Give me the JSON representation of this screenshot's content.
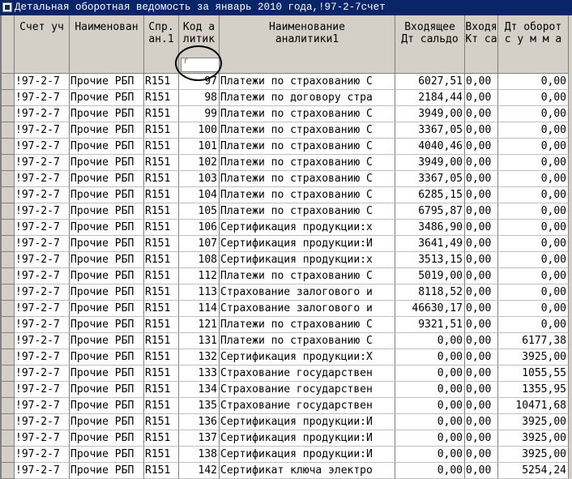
{
  "window": {
    "title": "Детальная оборотная ведомость за январь 2010 года,!97-2-7счет"
  },
  "table": {
    "columns": [
      {
        "key": "account",
        "label": "Счет уч"
      },
      {
        "key": "name",
        "label": "Наименован"
      },
      {
        "key": "ref",
        "label": "Спр.\nан.1"
      },
      {
        "key": "code",
        "label": "Код а\nлитик"
      },
      {
        "key": "analytic_name",
        "label": "Наименование\nаналитики1"
      },
      {
        "key": "opening_dt",
        "label": "Входящее\nДт сальдо"
      },
      {
        "key": "opening_kt",
        "label": "Входя\nКт са"
      },
      {
        "key": "turnover_dt",
        "label": "Дт оборот\nс у м м а"
      }
    ],
    "rows": [
      {
        "account": "!97-2-7",
        "name": "Прочие РБП",
        "ref": "R151",
        "code": "97",
        "analytic_name": "Платежи по страхованию С",
        "opening_dt": "6027,51",
        "opening_kt": "0,00",
        "turnover_dt": "0,00"
      },
      {
        "account": "!97-2-7",
        "name": "Прочие РБП",
        "ref": "R151",
        "code": "98",
        "analytic_name": "Платежи по договору стра",
        "opening_dt": "2184,44",
        "opening_kt": "0,00",
        "turnover_dt": "0,00"
      },
      {
        "account": "!97-2-7",
        "name": "Прочие РБП",
        "ref": "R151",
        "code": "99",
        "analytic_name": "Платежи по страхованию С",
        "opening_dt": "3949,00",
        "opening_kt": "0,00",
        "turnover_dt": "0,00"
      },
      {
        "account": "!97-2-7",
        "name": "Прочие РБП",
        "ref": "R151",
        "code": "100",
        "analytic_name": "Платежи по страхованию С",
        "opening_dt": "3367,05",
        "opening_kt": "0,00",
        "turnover_dt": "0,00"
      },
      {
        "account": "!97-2-7",
        "name": "Прочие РБП",
        "ref": "R151",
        "code": "101",
        "analytic_name": "Платежи по страхованию С",
        "opening_dt": "4040,46",
        "opening_kt": "0,00",
        "turnover_dt": "0,00"
      },
      {
        "account": "!97-2-7",
        "name": "Прочие РБП",
        "ref": "R151",
        "code": "102",
        "analytic_name": "Платежи по страхованию С",
        "opening_dt": "3949,00",
        "opening_kt": "0,00",
        "turnover_dt": "0,00"
      },
      {
        "account": "!97-2-7",
        "name": "Прочие РБП",
        "ref": "R151",
        "code": "103",
        "analytic_name": "Платежи по страхованию С",
        "opening_dt": "3367,05",
        "opening_kt": "0,00",
        "turnover_dt": "0,00"
      },
      {
        "account": "!97-2-7",
        "name": "Прочие РБП",
        "ref": "R151",
        "code": "104",
        "analytic_name": "Платежи по страхованию С",
        "opening_dt": "6285,15",
        "opening_kt": "0,00",
        "turnover_dt": "0,00"
      },
      {
        "account": "!97-2-7",
        "name": "Прочие РБП",
        "ref": "R151",
        "code": "105",
        "analytic_name": "Платежи по страхованию С",
        "opening_dt": "6795,87",
        "opening_kt": "0,00",
        "turnover_dt": "0,00"
      },
      {
        "account": "!97-2-7",
        "name": "Прочие РБП",
        "ref": "R151",
        "code": "106",
        "analytic_name": "Сертификация продукции:х",
        "opening_dt": "3486,90",
        "opening_kt": "0,00",
        "turnover_dt": "0,00"
      },
      {
        "account": "!97-2-7",
        "name": "Прочие РБП",
        "ref": "R151",
        "code": "107",
        "analytic_name": "Сертификация продукции:И",
        "opening_dt": "3641,49",
        "opening_kt": "0,00",
        "turnover_dt": "0,00"
      },
      {
        "account": "!97-2-7",
        "name": "Прочие РБП",
        "ref": "R151",
        "code": "108",
        "analytic_name": "Сертификация продукции:х",
        "opening_dt": "3513,15",
        "opening_kt": "0,00",
        "turnover_dt": "0,00"
      },
      {
        "account": "!97-2-7",
        "name": "Прочие РБП",
        "ref": "R151",
        "code": "112",
        "analytic_name": "Платежи по страхованию С",
        "opening_dt": "5019,00",
        "opening_kt": "0,00",
        "turnover_dt": "0,00"
      },
      {
        "account": "!97-2-7",
        "name": "Прочие РБП",
        "ref": "R151",
        "code": "113",
        "analytic_name": "Страхование залогового и",
        "opening_dt": "8118,52",
        "opening_kt": "0,00",
        "turnover_dt": "0,00"
      },
      {
        "account": "!97-2-7",
        "name": "Прочие РБП",
        "ref": "R151",
        "code": "114",
        "analytic_name": "Страхование залогового и",
        "opening_dt": "46630,17",
        "opening_kt": "0,00",
        "turnover_dt": "0,00"
      },
      {
        "account": "!97-2-7",
        "name": "Прочие РБП",
        "ref": "R151",
        "code": "121",
        "analytic_name": "Платежи по страхованию С",
        "opening_dt": "9321,51",
        "opening_kt": "0,00",
        "turnover_dt": "0,00"
      },
      {
        "account": "!97-2-7",
        "name": "Прочие РБП",
        "ref": "R151",
        "code": "131",
        "analytic_name": "Платежи по страхованию С",
        "opening_dt": "0,00",
        "opening_kt": "0,00",
        "turnover_dt": "6177,38"
      },
      {
        "account": "!97-2-7",
        "name": "Прочие РБП",
        "ref": "R151",
        "code": "132",
        "analytic_name": "Сертификация продукции:Х",
        "opening_dt": "0,00",
        "opening_kt": "0,00",
        "turnover_dt": "3925,00"
      },
      {
        "account": "!97-2-7",
        "name": "Прочие РБП",
        "ref": "R151",
        "code": "133",
        "analytic_name": "Страхование государствен",
        "opening_dt": "0,00",
        "opening_kt": "0,00",
        "turnover_dt": "1055,55"
      },
      {
        "account": "!97-2-7",
        "name": "Прочие РБП",
        "ref": "R151",
        "code": "134",
        "analytic_name": "Страхование государствен",
        "opening_dt": "0,00",
        "opening_kt": "0,00",
        "turnover_dt": "1355,95"
      },
      {
        "account": "!97-2-7",
        "name": "Прочие РБП",
        "ref": "R151",
        "code": "135",
        "analytic_name": "Страхование государствен",
        "opening_dt": "0,00",
        "opening_kt": "0,00",
        "turnover_dt": "10471,68"
      },
      {
        "account": "!97-2-7",
        "name": "Прочие РБП",
        "ref": "R151",
        "code": "136",
        "analytic_name": "Сертификация продукции:И",
        "opening_dt": "0,00",
        "opening_kt": "0,00",
        "turnover_dt": "3925,00"
      },
      {
        "account": "!97-2-7",
        "name": "Прочие РБП",
        "ref": "R151",
        "code": "137",
        "analytic_name": "Сертификация продукции:И",
        "opening_dt": "0,00",
        "opening_kt": "0,00",
        "turnover_dt": "3925,00"
      },
      {
        "account": "!97-2-7",
        "name": "Прочие РБП",
        "ref": "R151",
        "code": "138",
        "analytic_name": "Сертификация продукции:И",
        "opening_dt": "0,00",
        "opening_kt": "0,00",
        "turnover_dt": "3925,00"
      },
      {
        "account": "!97-2-7",
        "name": "Прочие РБП",
        "ref": "R151",
        "code": "142",
        "analytic_name": "Сертификат ключа электро",
        "opening_dt": "0,00",
        "opening_kt": "0,00",
        "turnover_dt": "5254,24"
      }
    ]
  }
}
